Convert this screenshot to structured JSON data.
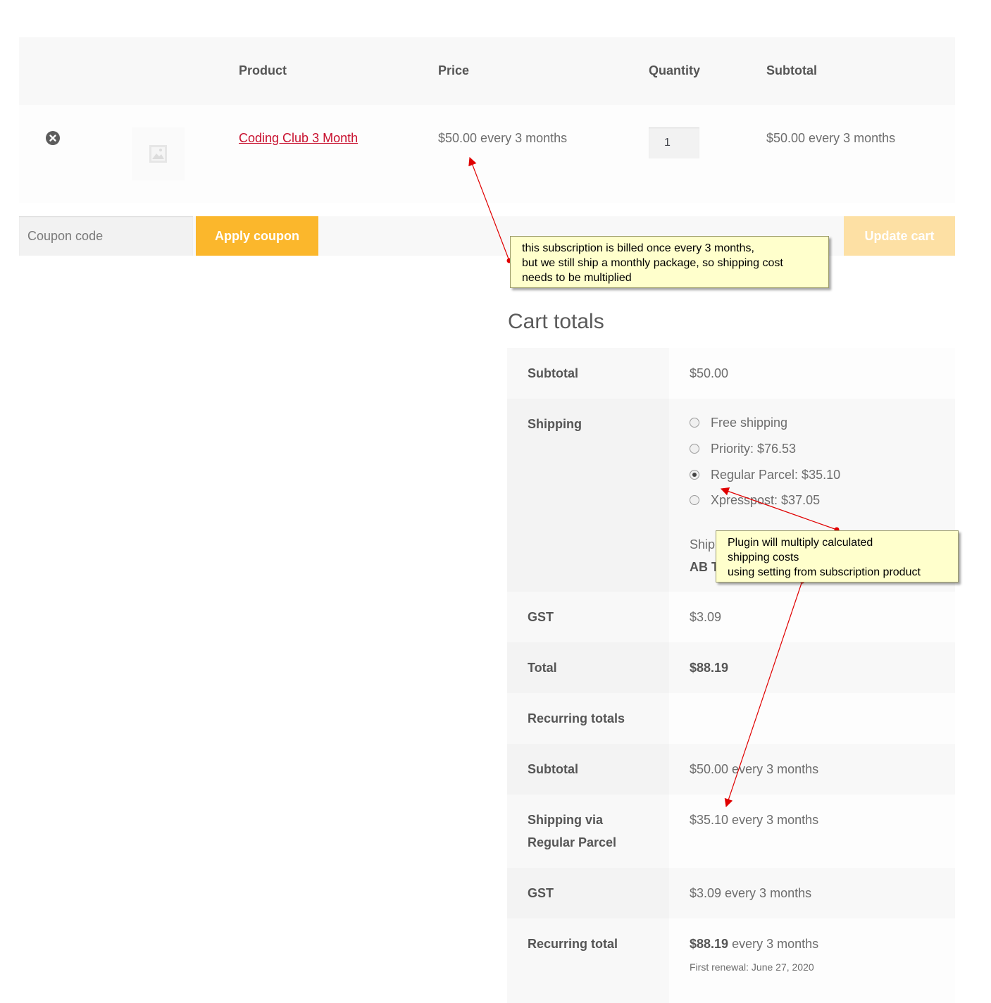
{
  "cart_table": {
    "headers": {
      "product": "Product",
      "price": "Price",
      "quantity": "Quantity",
      "subtotal": "Subtotal"
    },
    "row": {
      "product_name": "Coding Club 3 Month",
      "price": "$50.00 every 3 months",
      "quantity": "1",
      "subtotal": "$50.00 every 3 months"
    }
  },
  "actions": {
    "coupon_placeholder": "Coupon code",
    "apply_coupon_label": "Apply coupon",
    "update_cart_label": "Update cart"
  },
  "cart_totals": {
    "title": "Cart totals",
    "subtotal_label": "Subtotal",
    "subtotal_value": "$50.00",
    "shipping_label": "Shipping",
    "shipping_options": [
      {
        "label": "Free shipping",
        "selected": false
      },
      {
        "label": "Priority: $76.53",
        "selected": false
      },
      {
        "label": "Regular Parcel: $35.10",
        "selected": true
      },
      {
        "label": "Xpresspost: $37.05",
        "selected": false
      }
    ],
    "shipping_to_prefix": "Ship",
    "shipping_to_value": "AB T",
    "gst_label": "GST",
    "gst_value": "$3.09",
    "total_label": "Total",
    "total_value": "$88.19",
    "recurring_header": "Recurring totals",
    "recurring_subtotal_label": "Subtotal",
    "recurring_subtotal_value": "$50.00 every 3 months",
    "recurring_shipping_label_line1": "Shipping via",
    "recurring_shipping_label_line2": "Regular Parcel",
    "recurring_shipping_value": "$35.10 every 3 months",
    "recurring_gst_label": "GST",
    "recurring_gst_value": "$3.09 every 3 months",
    "recurring_total_label": "Recurring total",
    "recurring_total_amount": "$88.19",
    "recurring_total_period": "every 3 months",
    "first_renewal": "First renewal: June 27, 2020"
  },
  "annotations": [
    {
      "lines": [
        "this subscription is billed once every 3 months,",
        "but we still ship a monthly package, so shipping cost",
        "needs to be multiplied"
      ]
    },
    {
      "lines": [
        "Plugin will multiply calculated",
        "shipping costs",
        "using setting from subscription product"
      ]
    }
  ],
  "colors": {
    "accent_button": "#fbb72c",
    "link": "#c8102e",
    "annotation_bg": "#ffffcc",
    "arrow": "#e00000"
  }
}
